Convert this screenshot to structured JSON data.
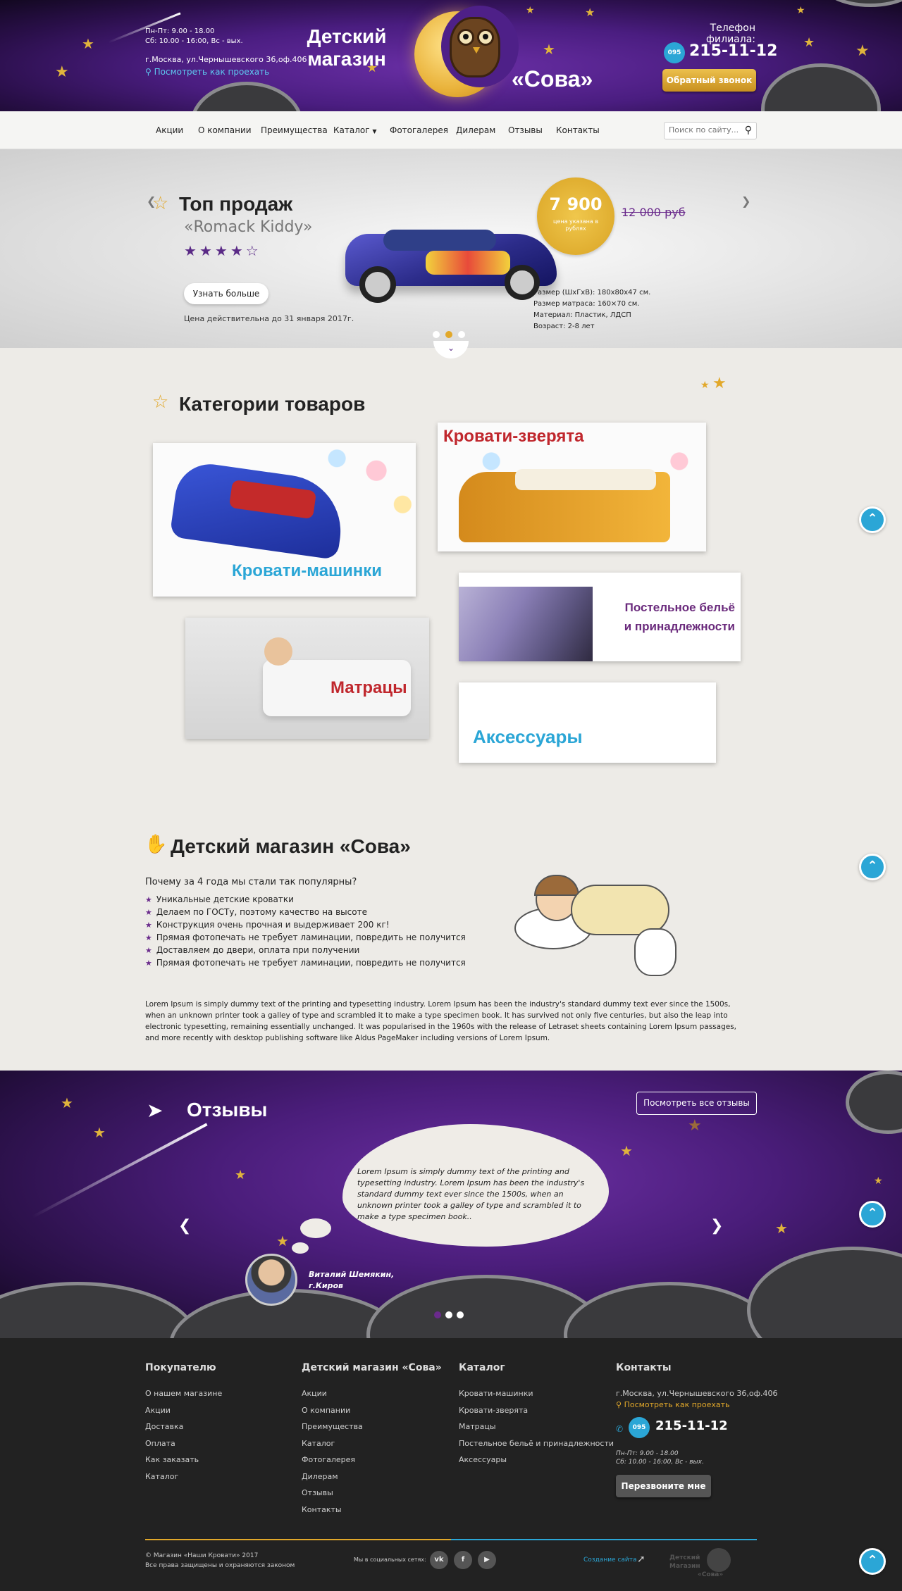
{
  "header": {
    "hours": "Пн-Пт: 9.00 - 18.00",
    "hours2": "Сб: 10.00 - 16:00, Вс - вых.",
    "address": "г.Москва, ул.Чернышевского 36,оф.406",
    "directions": "Посмотреть как проехать",
    "logo_line1": "Детский",
    "logo_line2": "магазин",
    "logo_line3": "«Сова»",
    "phone_label": "Телефон филиала:",
    "phone_code": "095",
    "phone": "215-11-12",
    "callback_button": "Обратный звонок"
  },
  "nav": {
    "items": [
      "Акции",
      "О компании",
      "Преимущества",
      "Каталог",
      "Фотогалерея",
      "Дилерам",
      "Отзывы",
      "Контакты"
    ],
    "search_placeholder": "Поиск по сайту..."
  },
  "hero": {
    "title": "Топ продаж",
    "product": "«Romack Kiddy»",
    "rating": 4,
    "rating_max": 5,
    "more_button": "Узнать больше",
    "valid": "Цена действительна до 31 января 2017г.",
    "price": "7 900",
    "price_note": "цена указана в рублях",
    "old_price": "12 000 руб",
    "specs": [
      "Размер (ШхГхВ): 180х80х47 см.",
      "Размер матраса: 160×70 см.",
      "Материал: Пластик, ЛДСП",
      "Возраст: 2-8 лет"
    ],
    "slides": 3,
    "active_slide": 1
  },
  "categories": {
    "title": "Категории товаров",
    "items": [
      "Кровати-машинки",
      "Кровати-зверята",
      "Постельное бельё",
      "и принадлежности",
      "Матрацы",
      "Аксессуары"
    ]
  },
  "about": {
    "title": "Детский магазин «Сова»",
    "subtitle": "Почему за 4 года мы стали так популярны?",
    "bullets": [
      "Уникальные детские кроватки",
      "Делаем по ГОСТу, поэтому качество на высоте",
      "Конструкция очень прочная и выдерживает 200 кг!",
      "Прямая фотопечать не требует ламинации, повредить не получится",
      "Доставляем до двери, оплата при получении",
      "Прямая фотопечать не требует ламинации, повредить не получится"
    ],
    "text": "Lorem Ipsum is simply dummy text of the printing and typesetting industry. Lorem Ipsum has been the industry's standard dummy text ever since the 1500s, when an unknown printer took a galley of type and scrambled it to make a type specimen book. It has survived not only five centuries, but also the leap into electronic typesetting, remaining essentially unchanged. It was popularised in the 1960s with the release of Letraset sheets containing Lorem Ipsum passages, and more recently with desktop publishing software like Aldus PageMaker including versions of Lorem Ipsum."
  },
  "reviews": {
    "title": "Отзывы",
    "all_button": "Посмотреть все отзывы",
    "quote": "Lorem Ipsum is simply dummy text of the printing and typesetting industry. Lorem Ipsum has been the industry's standard dummy text ever since the 1500s, when an unknown printer took a galley of type and scrambled it to make a type specimen book..",
    "author": "Виталий Шемякин,",
    "city": "г.Киров",
    "slides": 3,
    "active_slide": 0
  },
  "footer": {
    "col1_title": "Покупателю",
    "col1": [
      "О нашем магазине",
      "Акции",
      "Доставка",
      "Оплата",
      "Как заказать",
      "Каталог"
    ],
    "col2_title": "Детский магазин «Сова»",
    "col2": [
      "Акции",
      "О компании",
      "Преимущества",
      "Каталог",
      "Фотогалерея",
      "Дилерам",
      "Отзывы",
      "Контакты"
    ],
    "col3_title": "Каталог",
    "col3": [
      "Кровати-машинки",
      "Кровати-зверята",
      "Матрацы",
      "Постельное бельё и принадлежности",
      "Аксессуары"
    ],
    "col4_title": "Контакты",
    "address": "г.Москва, ул.Чернышевского 36,оф.406",
    "directions": "Посмотреть как проехать",
    "phone_code": "095",
    "phone": "215-11-12",
    "hours": "Пн-Пт: 9.00 - 18.00",
    "hours2": "Сб: 10.00 - 16:00, Вс - вых.",
    "call_button": "Перезвоните мне",
    "copyright": "© Магазин «Наши Кровати» 2017",
    "rights": "Все права защищены и охраняются законом",
    "social_label": "Мы в социальных сетях:",
    "social": [
      "vk-icon",
      "facebook-icon",
      "youtube-icon"
    ],
    "creator": "Создание сайта",
    "footer_logo1": "Детский",
    "footer_logo2": "Магазин",
    "footer_logo3": "«Сова»"
  },
  "colors": {
    "accent_blue": "#2ba6d6",
    "accent_gold": "#e2a82a",
    "purple": "#4a1d80"
  }
}
